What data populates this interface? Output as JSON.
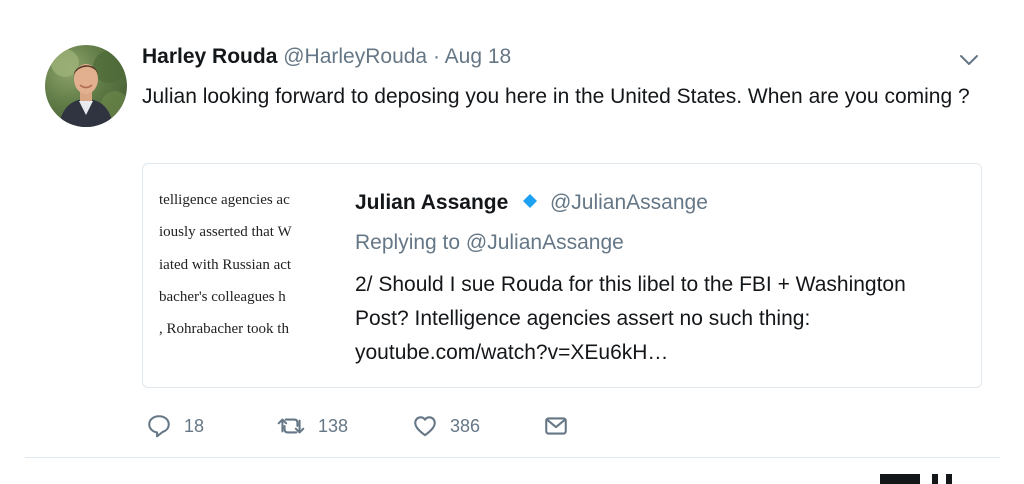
{
  "tweet": {
    "name": "Harley Rouda",
    "handle": "@HarleyRouda",
    "separator": "·",
    "date": "Aug 18",
    "text": "Julian looking forward to deposing you here in the United States. When are you coming ?",
    "avatar_icon": "profile-photo",
    "menu_icon": "chevron-down-icon"
  },
  "quoted": {
    "name": "Julian Assange",
    "verified_icon": "verified-badge-icon",
    "handle": "@JulianAssange",
    "replying_to": "Replying to @JulianAssange",
    "text": "2/ Should I sue Rouda for this libel to the FBI + Washington Post? Intelligence agencies assert no such thing: youtube.com/watch?v=XEu6kH…",
    "thumbnail_lines": [
      "telligence agencies ac",
      "iously asserted that W",
      "iated with Russian act",
      "bacher's colleagues h",
      ", Rohrabacher took th"
    ]
  },
  "actions": {
    "reply_count": "18",
    "retweet_count": "138",
    "like_count": "386",
    "icons": [
      "reply-icon",
      "retweet-icon",
      "like-icon",
      "direct-message-icon"
    ]
  },
  "colors": {
    "text": "#14171a",
    "secondary": "#657786",
    "border": "#e1e8ed",
    "verified": "#1da1f2"
  }
}
